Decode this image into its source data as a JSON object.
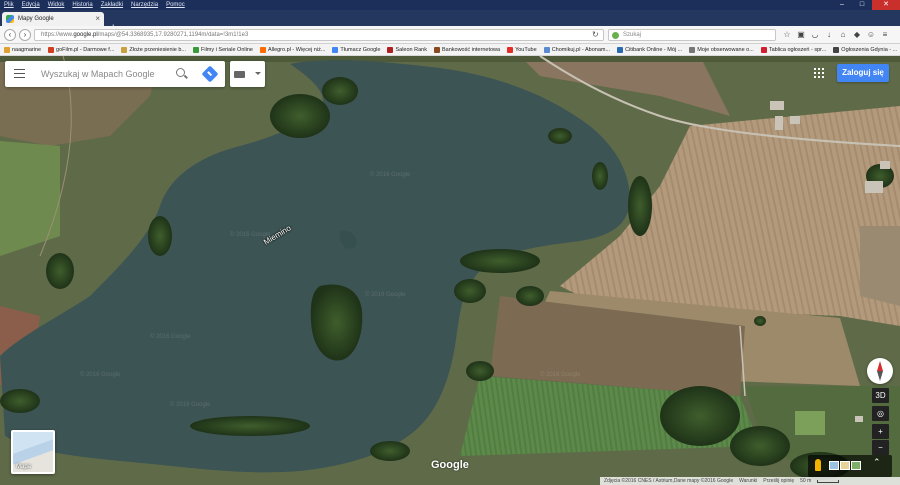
{
  "browser": {
    "menu": [
      "Plik",
      "Edycja",
      "Widok",
      "Historia",
      "Zakładki",
      "Narzędzia",
      "Pomoc"
    ],
    "tab_title": "Mapy Google",
    "url_prefix": "https://www.",
    "url_domain": "google.pl",
    "url_rest": "/maps/@54.3368935,17.9280271,1194m/data=!3m1!1e3",
    "search_placeholder": "Szukaj",
    "bookmarks": [
      {
        "label": "naagmarine",
        "color": "#e0a030"
      },
      {
        "label": "goFilm.pl - Darmowe f...",
        "color": "#d04020"
      },
      {
        "label": "Złoże przeniesienie b...",
        "color": "#c8a040"
      },
      {
        "label": "Filmy i Seriale Online",
        "color": "#3a9a3a"
      },
      {
        "label": "Allegro.pl - Więcej niż...",
        "color": "#ff6a00"
      },
      {
        "label": "Tłumacz Google",
        "color": "#4285f4"
      },
      {
        "label": "Saleon Rank",
        "color": "#b02020"
      },
      {
        "label": "Bankowość internetowa",
        "color": "#8a4a20"
      },
      {
        "label": "YouTube",
        "color": "#e52d27"
      },
      {
        "label": "Chomikuj.pl - Abonam...",
        "color": "#5a8ad0"
      },
      {
        "label": "Citibank Online - Mój ...",
        "color": "#2a6ab0"
      },
      {
        "label": "Moje obserwowane o...",
        "color": "#777777"
      },
      {
        "label": "Tablica ogłoszeń - spr...",
        "color": "#d02030"
      },
      {
        "label": "Ogłoszenia Gdynia - ...",
        "color": "#444444"
      },
      {
        "label": "YouTube",
        "color": "#e52d27"
      }
    ]
  },
  "maps": {
    "search_placeholder": "Wyszukaj w Mapach Google",
    "login_label": "Zaloguj się",
    "lake_label": "Miemino",
    "watermark": "© 2016 Google",
    "thumb_label": "Mapa",
    "google_logo": "Google",
    "btn_3d": "3D",
    "zoom_in": "+",
    "zoom_out": "−",
    "expand": "⌃",
    "footer": {
      "credits": "Zdjęcia ©2016 CNES / Astrium,Dane mapy ©2016 Google",
      "terms": "Warunki",
      "feedback": "Prześlij opinię",
      "scale": "50 m"
    }
  }
}
